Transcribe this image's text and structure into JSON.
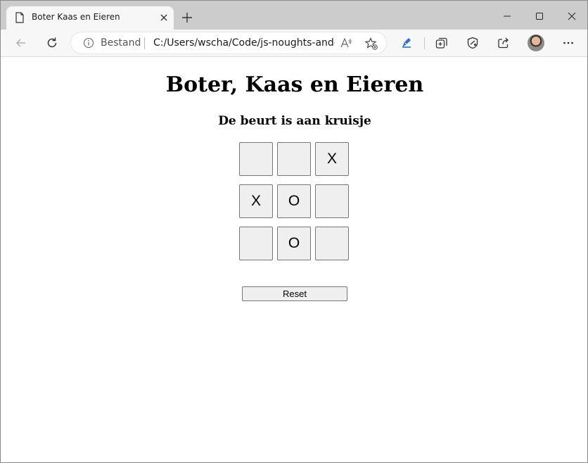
{
  "browser": {
    "tab": {
      "title": "Boter Kaas en Eieren",
      "icon": "page-icon"
    },
    "address_bar": {
      "scheme_label": "Bestand",
      "url": "C:/Users/wscha/Code/js-noughts-and-c..."
    },
    "window_controls": [
      "minimize-icon",
      "maximize-icon",
      "close-icon"
    ],
    "toolbar_icons": [
      "back-icon",
      "refresh-icon",
      "read-aloud-icon",
      "add-favorite-icon",
      "pen-icon",
      "collections-icon",
      "performance-icon",
      "share-icon",
      "profile-avatar",
      "more-icon"
    ],
    "accent_color": "#2a72d6"
  },
  "game": {
    "title": "Boter, Kaas en Eieren",
    "status": "De beurt is aan kruisje",
    "board": [
      [
        "",
        "",
        "X"
      ],
      [
        "X",
        "O",
        ""
      ],
      [
        "",
        "O",
        ""
      ]
    ],
    "reset_label": "Reset"
  }
}
